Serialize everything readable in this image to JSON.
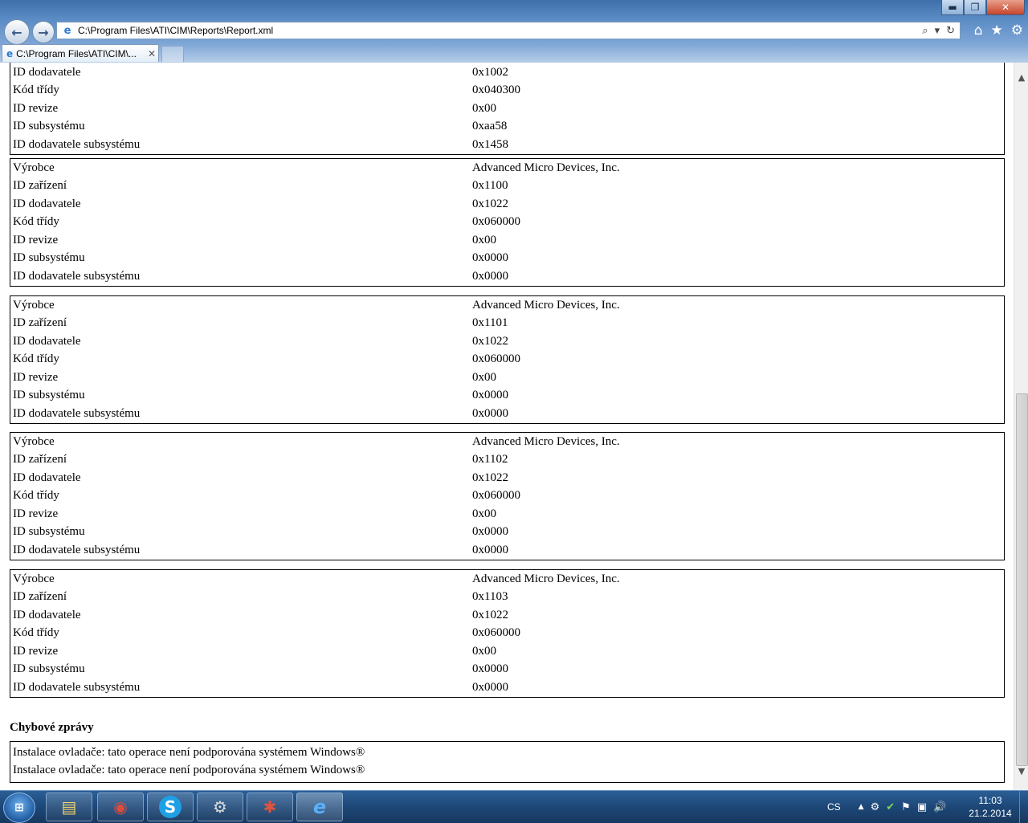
{
  "browser": {
    "address": "C:\\Program Files\\ATI\\CIM\\Reports\\Report.xml",
    "tab_title": "C:\\Program Files\\ATI\\CIM\\...",
    "tab_close": "✕",
    "window_buttons": {
      "minimize": "▬",
      "maximize": "❐",
      "close": "✕"
    },
    "nav": {
      "back": "←",
      "forward": "→"
    },
    "address_tools": {
      "search": "⌕",
      "dropdown": "▾",
      "refresh": "↻"
    },
    "commands": {
      "home": "⌂",
      "favorites": "★",
      "tools": "⚙"
    }
  },
  "report": {
    "partial_block": [
      {
        "key": "ID dodavatele",
        "value": "0x1002"
      },
      {
        "key": "Kód třídy",
        "value": "0x040300"
      },
      {
        "key": "ID revize",
        "value": "0x00"
      },
      {
        "key": "ID subsystému",
        "value": "0xaa58"
      },
      {
        "key": "ID dodavatele subsystému",
        "value": "0x1458"
      }
    ],
    "devices": [
      [
        {
          "key": "Výrobce",
          "value": "Advanced Micro Devices, Inc."
        },
        {
          "key": "ID zařízení",
          "value": "0x1100"
        },
        {
          "key": "ID dodavatele",
          "value": "0x1022"
        },
        {
          "key": "Kód třídy",
          "value": "0x060000"
        },
        {
          "key": "ID revize",
          "value": "0x00"
        },
        {
          "key": "ID subsystému",
          "value": "0x0000"
        },
        {
          "key": "ID dodavatele subsystému",
          "value": "0x0000"
        }
      ],
      [
        {
          "key": "Výrobce",
          "value": "Advanced Micro Devices, Inc."
        },
        {
          "key": "ID zařízení",
          "value": "0x1101"
        },
        {
          "key": "ID dodavatele",
          "value": "0x1022"
        },
        {
          "key": "Kód třídy",
          "value": "0x060000"
        },
        {
          "key": "ID revize",
          "value": "0x00"
        },
        {
          "key": "ID subsystému",
          "value": "0x0000"
        },
        {
          "key": "ID dodavatele subsystému",
          "value": "0x0000"
        }
      ],
      [
        {
          "key": "Výrobce",
          "value": "Advanced Micro Devices, Inc."
        },
        {
          "key": "ID zařízení",
          "value": "0x1102"
        },
        {
          "key": "ID dodavatele",
          "value": "0x1022"
        },
        {
          "key": "Kód třídy",
          "value": "0x060000"
        },
        {
          "key": "ID revize",
          "value": "0x00"
        },
        {
          "key": "ID subsystému",
          "value": "0x0000"
        },
        {
          "key": "ID dodavatele subsystému",
          "value": "0x0000"
        }
      ],
      [
        {
          "key": "Výrobce",
          "value": "Advanced Micro Devices, Inc."
        },
        {
          "key": "ID zařízení",
          "value": "0x1103"
        },
        {
          "key": "ID dodavatele",
          "value": "0x1022"
        },
        {
          "key": "Kód třídy",
          "value": "0x060000"
        },
        {
          "key": "ID revize",
          "value": "0x00"
        },
        {
          "key": "ID subsystému",
          "value": "0x0000"
        },
        {
          "key": "ID dodavatele subsystému",
          "value": "0x0000"
        }
      ]
    ],
    "errors_heading": "Chybové zprávy",
    "errors": [
      "Instalace ovladače: tato operace není podporována systémem Windows®",
      "Instalace ovladače: tato operace není podporována systémem Windows®"
    ]
  },
  "scrollbar": {
    "up": "▲",
    "down": "▼"
  },
  "taskbar": {
    "start": "⊞",
    "apps": {
      "explorer": "▤",
      "chrome": "◉",
      "skype": "S",
      "steam": "⚙",
      "app": "✱",
      "ie": "e"
    },
    "tray": {
      "language": "CS",
      "show_hidden": "▲",
      "steam": "⚙",
      "security": "✔",
      "flag": "⚑",
      "network": "▣",
      "volume": "🔊"
    },
    "time": "11:03",
    "date": "21.2.2014"
  }
}
